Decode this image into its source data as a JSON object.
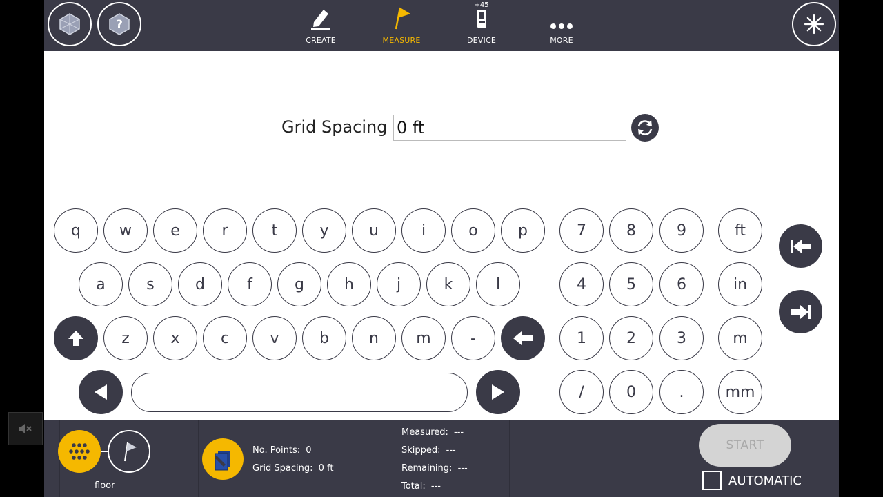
{
  "topbar": {
    "nav": [
      {
        "label": "CREATE",
        "icon": "pencil-icon",
        "active": false
      },
      {
        "label": "MEASURE",
        "icon": "flag-icon",
        "active": true
      },
      {
        "label": "DEVICE",
        "icon": "total-station-icon",
        "active": false,
        "badge": "45"
      },
      {
        "label": "MORE",
        "icon": "more-dots-icon",
        "active": false
      }
    ],
    "left_buttons": [
      "cube-icon",
      "help-icon"
    ],
    "right_button": "laser-icon"
  },
  "form": {
    "grid_spacing_label": "Grid Spacing",
    "grid_spacing_value": "0 ft"
  },
  "keyboard": {
    "row1": [
      "q",
      "w",
      "e",
      "r",
      "t",
      "y",
      "u",
      "i",
      "o",
      "p"
    ],
    "row2": [
      "a",
      "s",
      "d",
      "f",
      "g",
      "h",
      "j",
      "k",
      "l"
    ],
    "row3": [
      "z",
      "x",
      "c",
      "v",
      "b",
      "n",
      "m",
      "-"
    ],
    "numpad": [
      [
        "7",
        "8",
        "9",
        "ft"
      ],
      [
        "4",
        "5",
        "6",
        "in"
      ],
      [
        "1",
        "2",
        "3",
        "m"
      ],
      [
        "/",
        "0",
        ".",
        "mm"
      ]
    ]
  },
  "bottombar": {
    "layer_name": "floor",
    "no_points_label": "No. Points:",
    "no_points_value": "0",
    "grid_spacing_label": "Grid Spacing:",
    "grid_spacing_value": "0 ft",
    "measured_label": "Measured:",
    "measured_value": "---",
    "skipped_label": "Skipped:",
    "skipped_value": "---",
    "remaining_label": "Remaining:",
    "remaining_value": "---",
    "total_label": "Total:",
    "total_value": "---",
    "start_label": "START",
    "automatic_label": "AUTOMATIC"
  },
  "colors": {
    "bar": "#3a3a47",
    "accent": "#f5b800",
    "start_disabled": "#d4d4d4"
  }
}
